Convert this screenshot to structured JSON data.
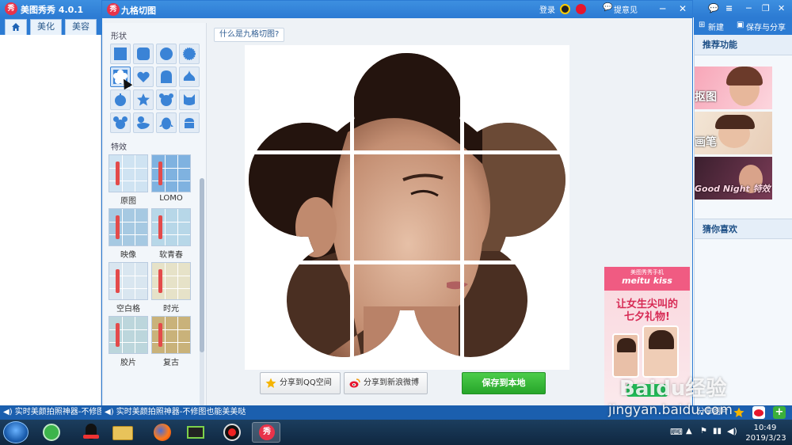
{
  "main_app": {
    "title": "美图秀秀 4.0.1",
    "tabs": [
      {
        "label": "美化"
      },
      {
        "label": "美容"
      }
    ],
    "right_toolbar": {
      "new_label": "新建",
      "save_share_label": "保存与分享"
    },
    "right_pane": {
      "recommended_title": "推荐功能",
      "recommended_items": [
        {
          "label": "抠图"
        },
        {
          "label": "画笔"
        },
        {
          "label": "Good Night 特效"
        }
      ],
      "guess_title": "猜你喜欢"
    }
  },
  "dialog": {
    "title": "九格切图",
    "login_label": "登录",
    "feedback_label": "提意见",
    "help_link": "什么是九格切图?",
    "shape_section_label": "形状",
    "effects_section_label": "特效",
    "shapes": [
      {
        "icon": "square-icon"
      },
      {
        "icon": "rounded-square-icon"
      },
      {
        "icon": "circle-icon"
      },
      {
        "icon": "seal-icon"
      },
      {
        "icon": "flower-icon",
        "selected": true
      },
      {
        "icon": "heart-icon"
      },
      {
        "icon": "arch-icon"
      },
      {
        "icon": "drop-icon"
      },
      {
        "icon": "apple-icon"
      },
      {
        "icon": "star-icon"
      },
      {
        "icon": "bear-icon"
      },
      {
        "icon": "cat-icon"
      },
      {
        "icon": "mouse-icon"
      },
      {
        "icon": "duck-icon"
      },
      {
        "icon": "penguin-icon"
      },
      {
        "icon": "android-icon"
      }
    ],
    "effects": [
      {
        "label": "原图"
      },
      {
        "label": "LOMO"
      },
      {
        "label": "映像"
      },
      {
        "label": "软青春"
      },
      {
        "label": "空白格"
      },
      {
        "label": "时光"
      },
      {
        "label": "胶片"
      },
      {
        "label": "复古"
      }
    ],
    "share_qzone_label": "分享到QQ空间",
    "share_weibo_label": "分享到新浪微博",
    "save_local_label": "保存到本地"
  },
  "ad": {
    "brand_small": "美图秀秀手机",
    "brand": "meitu kiss",
    "line1": "让女生尖叫的",
    "line2": "七夕礼物!"
  },
  "status": {
    "left_text": "实时美颜拍照神器-不修图",
    "mid_text": "实时美颜拍照神器-不修图也能美美哒",
    "right_text": "分享图片"
  },
  "taskbar": {
    "time": "10:49",
    "date": "2019/3/23"
  },
  "watermark": {
    "brand_text": "Baidu经验",
    "url_text": "jingyan.baidu.com"
  },
  "colors": {
    "titlebar_blue": "#2c7bd3",
    "save_green": "#27a52a",
    "shape_blue": "#3a83d6"
  }
}
